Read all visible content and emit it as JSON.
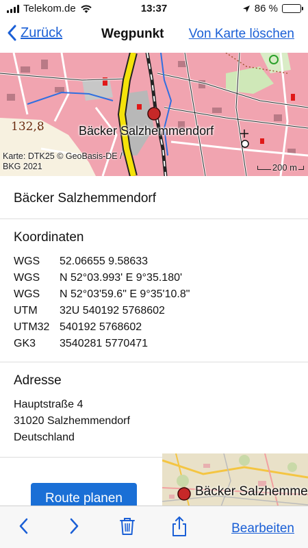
{
  "status_bar": {
    "carrier": "Telekom.de",
    "time": "13:37",
    "battery": "86 %",
    "battery_level": 0.86,
    "icons": [
      "signal-icon",
      "wifi-icon",
      "location-arrow-icon",
      "battery-icon"
    ]
  },
  "nav": {
    "back_label": "Zurück",
    "title": "Wegpunkt",
    "action_label": "Von Karte löschen"
  },
  "map": {
    "marker_label": "Bäcker Salzhemmendorf",
    "elevation_label": "132,8",
    "credit_line1": "Karte: DTK25 © GeoBasis-DE /",
    "credit_line2": "BKG 2021",
    "scale_label": "200 m"
  },
  "waypoint": {
    "name": "Bäcker Salzhemmendorf"
  },
  "coordinates": {
    "heading": "Koordinaten",
    "rows": [
      {
        "system": "WGS",
        "value": "52.06655  9.58633"
      },
      {
        "system": "WGS",
        "value": "N 52°03.993'  E 9°35.180'"
      },
      {
        "system": "WGS",
        "value": "N 52°03'59.6\"  E 9°35'10.8\""
      },
      {
        "system": "UTM",
        "value": "32U  540192  5768602"
      },
      {
        "system": "UTM32",
        "value": "540192  5768602"
      },
      {
        "system": "GK3",
        "value": "3540281  5770471"
      }
    ]
  },
  "address": {
    "heading": "Adresse",
    "line1": "Hauptstraße 4",
    "line2": "31020 Salzhemmendorf",
    "line3": "Deutschland"
  },
  "actions": {
    "route_label": "Route planen",
    "mini_map_label": "Bäcker Salzhemme"
  },
  "toolbar": {
    "edit_label": "Bearbeiten",
    "icons": [
      "chevron-left-icon",
      "chevron-right-icon",
      "trash-icon",
      "share-icon"
    ]
  },
  "colors": {
    "accent": "#1a5fd6",
    "button": "#1a6fd6",
    "map_residential": "#f1a4b0",
    "map_main_road": "#f4e20a",
    "marker": "#c62828"
  }
}
